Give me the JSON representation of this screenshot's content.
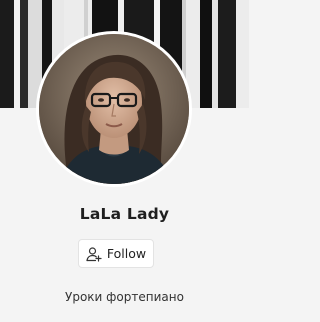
{
  "profile": {
    "name": "LaLa Lady",
    "follow_label": "Follow",
    "description": "Уроки фортепиано"
  },
  "icons": {
    "follow": "user-plus-icon"
  },
  "colors": {
    "page_background": "#f4f4f4",
    "card_button_background": "#ffffff",
    "text_primary": "#1f1f1f"
  }
}
